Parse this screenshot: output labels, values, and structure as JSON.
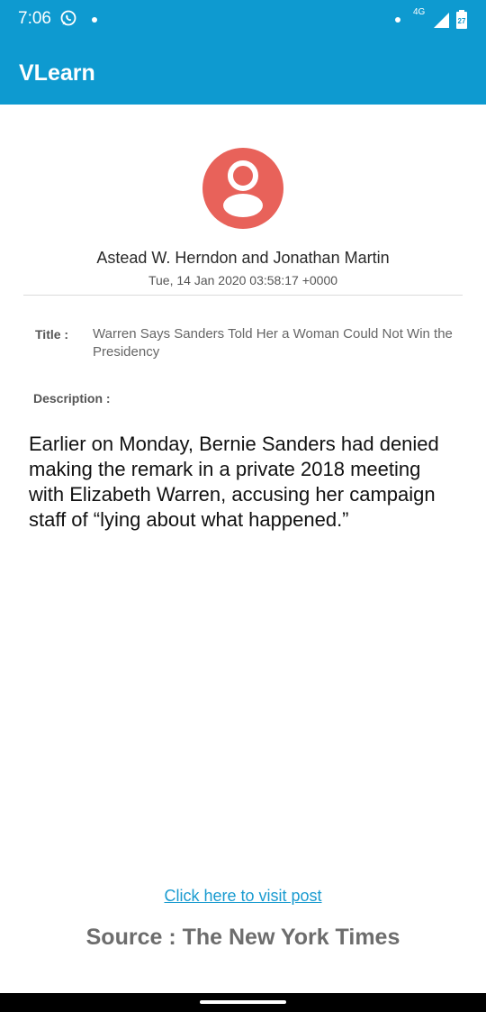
{
  "status_bar": {
    "time": "7:06",
    "network": "4G",
    "battery": "27",
    "icons": [
      "whatsapp-icon",
      "notification-dot-icon",
      "signal-icon",
      "battery-icon"
    ]
  },
  "app_bar": {
    "title": "VLearn",
    "color": "#0e9ad0"
  },
  "article": {
    "avatar_icon": "person-icon",
    "avatar_color": "#e8625a",
    "author": "Astead W. Herndon and Jonathan Martin",
    "date": "Tue, 14 Jan 2020 03:58:17 +0000",
    "title_label": "Title :",
    "title_value": "Warren Says Sanders Told Her a Woman Could Not Win the Presidency",
    "description_label": "Description :",
    "description": "Earlier on Monday, Bernie Sanders had denied making the remark in a private 2018 meeting with Elizabeth Warren, accusing her campaign staff of “lying about what happened.”"
  },
  "footer": {
    "link_text": "Click here to visit post",
    "source": "Source : The New York Times"
  }
}
